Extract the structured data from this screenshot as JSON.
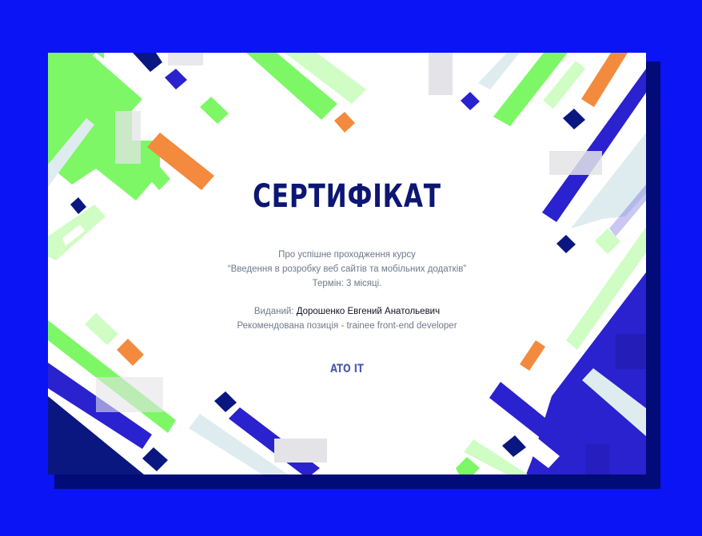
{
  "certificate": {
    "title": "СЕРТИФІКАТ",
    "course_intro": "Про успішне проходження курсу",
    "course_name": "“Введення в розробку веб сайтів та мобільних додатків”",
    "duration": "Термін: 3 місяці.",
    "issued_label": "Виданий:",
    "recipient": "Дорошенко Евгений Анатольевич",
    "recommendation": "Рекомендована позиція - trainee front-end developer",
    "issuer": "ATO IT"
  },
  "colors": {
    "background": "#0A14F5",
    "shadow": "#020B78",
    "title": "#0D1673",
    "green": "#7DF766",
    "light_green": "#CFFDC4",
    "orange": "#F48A3D",
    "blue": "#2A21CF",
    "navy": "#0A1780",
    "pale": "#DFECEF",
    "gray": "#E4E4E8"
  }
}
